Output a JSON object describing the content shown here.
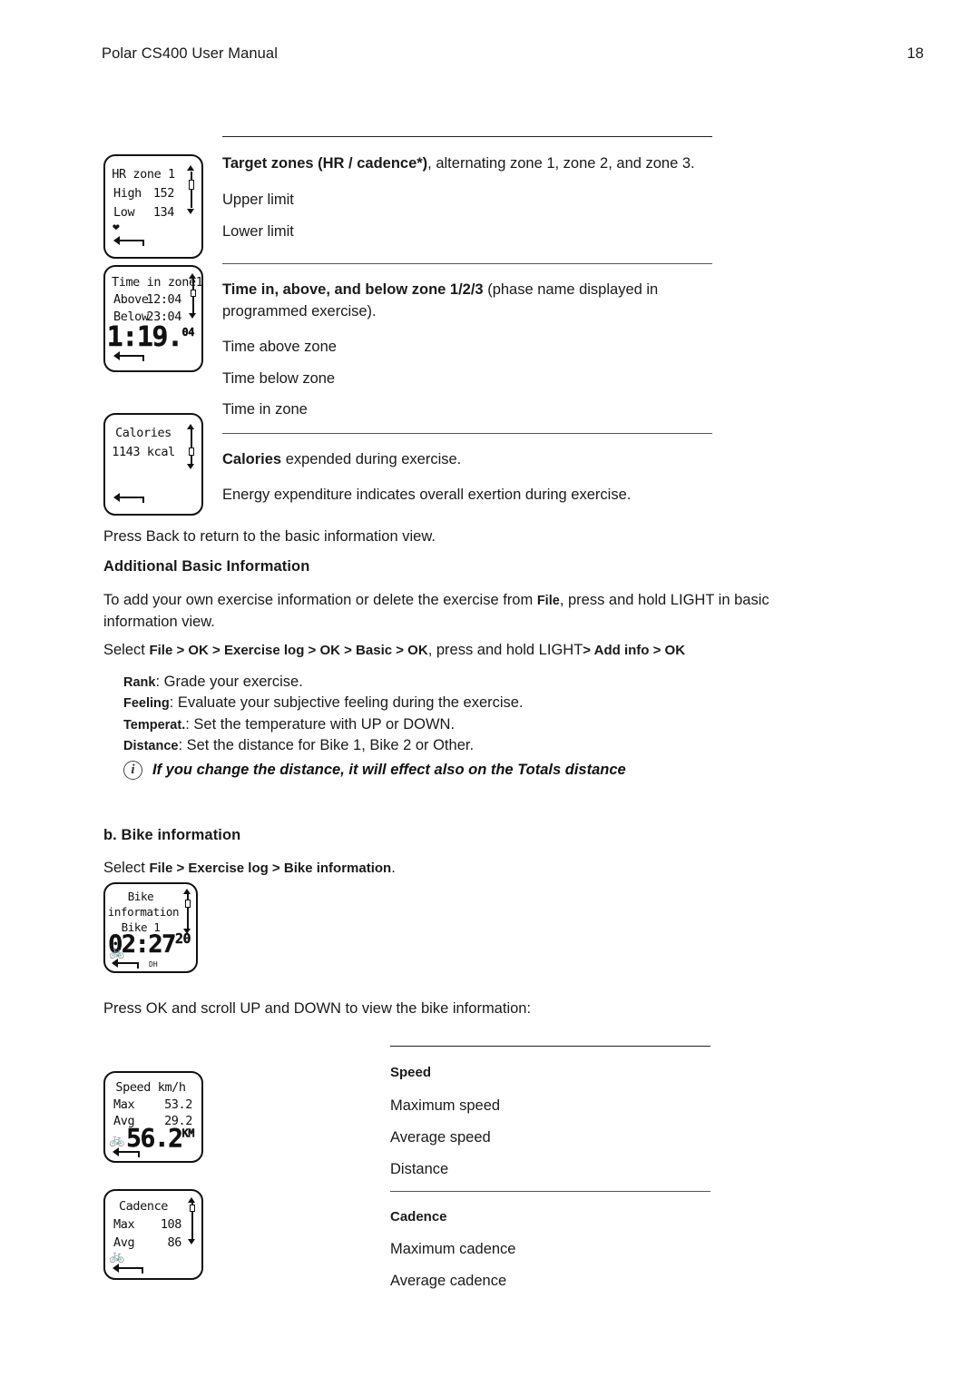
{
  "header": {
    "title": "Polar CS400 User Manual",
    "page_number": "18"
  },
  "displays": {
    "hr_zone": {
      "title": "HR zone 1",
      "rows": [
        {
          "label": "High",
          "value": "152"
        },
        {
          "label": "Low",
          "value": "134"
        }
      ],
      "heart_icon": "heart-icon",
      "back_icon": "back-arrow-icon",
      "scroll_icon": "scroll-indicator"
    },
    "time_in_zone": {
      "title": "Time in zone1",
      "rows": [
        {
          "label": "Above",
          "value": "12:04"
        },
        {
          "label": "Below",
          "value": "23:04"
        }
      ],
      "big_value": "1:19.",
      "big_value_sup": "04",
      "back_icon": "back-arrow-icon",
      "scroll_icon": "scroll-indicator"
    },
    "calories": {
      "title": "Calories",
      "value": "1143 kcal",
      "back_icon": "back-arrow-icon",
      "scroll_icon": "scroll-indicator"
    },
    "bike_information": {
      "line1": "Bike",
      "line2": "information",
      "line3": "Bike 1",
      "big_value": "02:27",
      "big_value_sup": "20",
      "sub_label": "DH",
      "bike_icon": "bicycle-icon",
      "back_icon": "back-arrow-icon",
      "scroll_icon": "scroll-indicator"
    },
    "speed": {
      "title": "Speed km/h",
      "rows": [
        {
          "label": "Max",
          "value": "53.2"
        },
        {
          "label": "Avg",
          "value": "29.2"
        }
      ],
      "big_value": "56.2",
      "big_unit": "KM",
      "bike_icon": "bicycle-icon",
      "back_icon": "back-arrow-icon"
    },
    "cadence": {
      "title": "Cadence",
      "rows": [
        {
          "label": "Max",
          "value": "108"
        },
        {
          "label": "Avg",
          "value": "86"
        }
      ],
      "bike_icon": "bicycle-icon",
      "back_icon": "back-arrow-icon",
      "scroll_icon": "scroll-indicator"
    }
  },
  "table_zones": {
    "target_zones": {
      "bold": "Target zones (HR / cadence*)",
      "rest": ", alternating zone 1, zone 2, and zone 3.",
      "items": [
        "Upper limit",
        "Lower limit"
      ]
    },
    "time_zone": {
      "bold": "Time in, above, and below zone 1/2/3",
      "rest": " (phase name displayed in programmed exercise).",
      "items": [
        "Time above zone",
        "Time below zone",
        "Time in zone"
      ]
    },
    "calories": {
      "bold": "Calories",
      "rest": " expended during exercise.",
      "items": [
        "Energy expenditure indicates overall exertion during exercise."
      ]
    }
  },
  "body": {
    "press_back": "Press Back to return to the basic information view.",
    "additional_heading": "Additional Basic Information",
    "add_info_p1_a": "To add your own exercise information or delete the exercise from ",
    "add_info_p1_file": "File",
    "add_info_p1_b": ", press and hold LIGHT in basic information view.",
    "select_prefix": "Select ",
    "select_path_1": "File > OK > Exercise log > OK > Basic > OK",
    "select_mid": ", press and hold LIGHT",
    "select_path_2": "> Add info > OK",
    "definitions": [
      {
        "term": "Rank",
        "desc": ": Grade your exercise."
      },
      {
        "term": "Feeling",
        "desc": ": Evaluate your subjective feeling during the exercise."
      },
      {
        "term": "Temperat.",
        "desc": ": Set the temperature with UP or DOWN."
      },
      {
        "term": "Distance",
        "desc": ": Set the distance for Bike 1, Bike 2 or Other."
      }
    ],
    "info_note": "If you change the distance, it will effect also on the Totals distance",
    "bike_heading": "b. Bike information",
    "bike_select_prefix": "Select ",
    "bike_select_path": "File > Exercise log > Bike information",
    "bike_select_suffix": ".",
    "press_ok": "Press OK and scroll UP and DOWN to view the bike information:"
  },
  "table_bike": {
    "speed": {
      "head": "Speed",
      "items": [
        "Maximum speed",
        "Average speed",
        "Distance"
      ]
    },
    "cadence": {
      "head": "Cadence",
      "items": [
        "Maximum cadence",
        "Average cadence"
      ]
    }
  }
}
